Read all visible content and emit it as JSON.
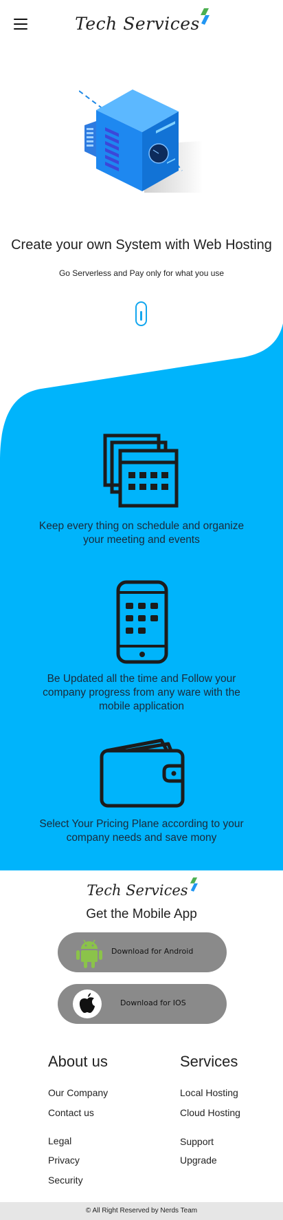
{
  "header": {
    "brand": "Tech Services",
    "menu_icon": "hamburger-icon"
  },
  "hero": {
    "title": "Create your own System with Web Hosting",
    "subtitle": "Go Serverless and Pay only for what you use",
    "illustration": "server-illustration"
  },
  "features": [
    {
      "icon": "calendar-icon",
      "text": "Keep every thing on schedule and organize your meeting and events"
    },
    {
      "icon": "smartphone-icon",
      "text": "Be Updated all the time and Follow your company progress from any ware with the mobile application"
    },
    {
      "icon": "wallet-icon",
      "text": "Select Your Pricing Plane according to your company needs and save mony"
    }
  ],
  "mobile_app": {
    "brand": "Tech Services",
    "heading": "Get the Mobile App",
    "android_label": "Download for Android",
    "ios_label": "Download for IOS"
  },
  "footer": {
    "about": {
      "title": "About us",
      "links": [
        "Our Company",
        "Contact us",
        "Legal",
        "Privacy",
        "Security"
      ]
    },
    "services": {
      "title": "Services",
      "links": [
        "Local Hosting",
        "Cloud Hosting",
        "Support",
        "Upgrade"
      ]
    },
    "copyright": "© All Right Reserved by Nerds Team"
  },
  "colors": {
    "accent_blue": "#00b4fb",
    "scroll_indicator": "#12a6ee",
    "button_gray": "#8a8a8a",
    "android_green": "#8bc34a",
    "brand_green": "#4caf50",
    "brand_blue": "#2196f3"
  }
}
